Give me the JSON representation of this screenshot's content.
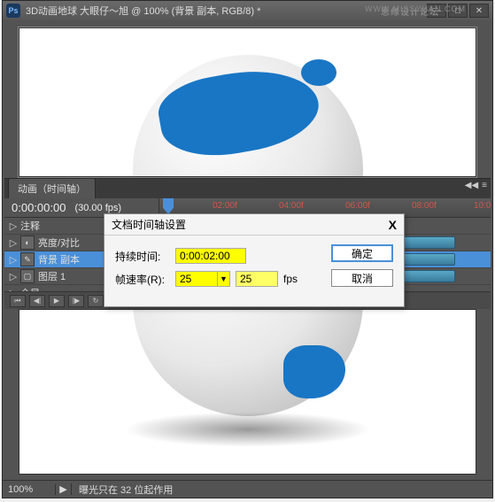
{
  "window": {
    "title": "3D动画地球    大眼仔～旭 @ 100% (背景 副本, RGB/8) *",
    "watermark": "思缘设计论坛",
    "watermark_url": "WWW.MISSYUAN.COM"
  },
  "animation_panel": {
    "tab_label": "动画（时间轴）",
    "timecode": "0:00:00:00",
    "fps_display": "(30.00 fps)",
    "ruler": {
      "t1": "02:00f",
      "t2": "04:00f",
      "t3": "06:00f",
      "t4": "08:00f",
      "t5": "10:0"
    },
    "layers": {
      "row0": "注释",
      "row1": "亮度/对比",
      "row2": "背景 副本",
      "row3": "图层 1",
      "row4": "全局"
    }
  },
  "dialog": {
    "title": "文档时间轴设置",
    "duration_label": "持续时间:",
    "duration_value": "0:00:02:00",
    "fps_label": "帧速率(R):",
    "fps_value": "25",
    "fps_value2": "25",
    "fps_unit": "fps",
    "ok_label": "确定",
    "cancel_label": "取消",
    "close": "X"
  },
  "statusbar": {
    "zoom": "100%",
    "info": "曝光只在 32 位起作用"
  },
  "ps_icon": "Ps"
}
